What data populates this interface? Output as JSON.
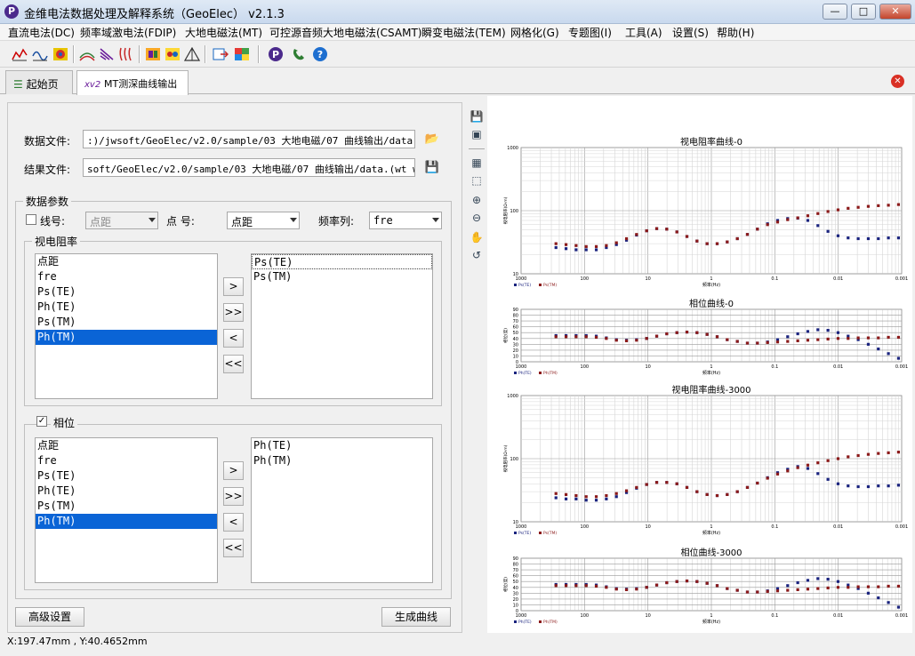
{
  "window": {
    "title": "金维电法数据处理及解释系统（GeoElec） v2.1.3",
    "logo": "P"
  },
  "menu": [
    "直流电法(DC)",
    "频率域激电法(FDIP)",
    "大地电磁法(MT)",
    "可控源音频大地电磁法(CSAMT)",
    "瞬变电磁法(TEM)",
    "网格化(G)",
    "专题图(I)",
    "工具(A)",
    "设置(S)",
    "帮助(H)"
  ],
  "tabs": [
    {
      "label": "起始页"
    },
    {
      "label": "MT测深曲线输出"
    }
  ],
  "form": {
    "data_file_label": "数据文件:",
    "data_file": ":)/jwsoft/GeoElec/v2.0/sample/03 大地电磁/07 曲线输出/data.csv",
    "result_file_label": "结果文件:",
    "result_file": "soft/GeoElec/v2.0/sample/03 大地电磁/07 曲线输出/data.(wt wl)",
    "params_title": "数据参数",
    "line_label": "线号:",
    "line_value": "点距",
    "point_label": "点  号:",
    "point_value": "点距",
    "freq_label": "频率列:",
    "freq_value": "fre",
    "rho_title": "视电阻率",
    "rho_left": [
      "点距",
      "fre",
      "Ps(TE)",
      "Ph(TE)",
      "Ps(TM)",
      "Ph(TM)"
    ],
    "rho_right": [
      "Ps(TE)",
      "Ps(TM)"
    ],
    "phase_title": "相位",
    "phase_checked": true,
    "phase_left": [
      "点距",
      "fre",
      "Ps(TE)",
      "Ph(TE)",
      "Ps(TM)",
      "Ph(TM)"
    ],
    "phase_right": [
      "Ph(TE)",
      "Ph(TM)"
    ],
    "move": [
      ">",
      ">>",
      "<",
      "<<"
    ],
    "advanced": "高级设置",
    "generate": "生成曲线"
  },
  "status": "X:197.47mm , Y:40.4652mm",
  "chart_data": [
    {
      "type": "scatter",
      "title": "视电阻率曲线-0",
      "xlabel": "频率(Hz)",
      "ylabel": "视电阻率(Ω·m)",
      "x_reversed": true,
      "log_x": true,
      "log_y": true,
      "ylim": [
        10,
        1000
      ],
      "xticks": [
        "1000",
        "100",
        "10",
        "1",
        "0.1",
        "0.01",
        "0.001"
      ],
      "yticks": [
        "1000",
        "100",
        "10"
      ],
      "series": [
        {
          "name": "Ps(TE)",
          "color": "#1a237e",
          "values": [
            26,
            25,
            24,
            24,
            24,
            26,
            29,
            34,
            41,
            48,
            52,
            51,
            46,
            39,
            33,
            30,
            30,
            32,
            36,
            42,
            51,
            62,
            70,
            75,
            76,
            70,
            58,
            47,
            40,
            37,
            36,
            36,
            36,
            37,
            37
          ]
        },
        {
          "name": "Ps(TM)",
          "color": "#8b1a1a",
          "values": [
            30,
            29,
            28,
            27,
            27,
            28,
            31,
            36,
            42,
            48,
            52,
            51,
            46,
            39,
            33,
            30,
            30,
            32,
            36,
            42,
            51,
            60,
            66,
            72,
            77,
            83,
            90,
            97,
            103,
            109,
            113,
            117,
            120,
            122,
            125
          ]
        }
      ]
    },
    {
      "type": "scatter",
      "title": "相位曲线-0",
      "xlabel": "频率(Hz)",
      "ylabel": "相位(度)",
      "x_reversed": true,
      "log_x": true,
      "ylim": [
        0,
        90
      ],
      "xticks": [
        "1000",
        "100",
        "10",
        "1",
        "0.1",
        "0.01",
        "0.001"
      ],
      "yticks": [
        "90",
        "80",
        "70",
        "60",
        "50",
        "40",
        "30",
        "20",
        "10",
        "0"
      ],
      "series": [
        {
          "name": "Ph(TE)",
          "color": "#1a237e",
          "values": [
            45,
            45,
            45,
            45,
            44,
            41,
            38,
            37,
            38,
            40,
            44,
            48,
            50,
            51,
            50,
            47,
            43,
            38,
            35,
            32,
            32,
            34,
            38,
            43,
            48,
            52,
            55,
            54,
            50,
            44,
            38,
            30,
            22,
            14,
            6
          ]
        },
        {
          "name": "Ph(TM)",
          "color": "#8b1a1a",
          "values": [
            43,
            43,
            43,
            43,
            42,
            40,
            37,
            36,
            37,
            40,
            44,
            48,
            50,
            51,
            50,
            47,
            43,
            38,
            35,
            32,
            32,
            33,
            34,
            35,
            36,
            37,
            38,
            39,
            40,
            40,
            41,
            41,
            41,
            42,
            42
          ]
        }
      ]
    },
    {
      "type": "scatter",
      "title": "视电阻率曲线-3000",
      "xlabel": "频率(Hz)",
      "ylabel": "视电阻率(Ω·m)",
      "x_reversed": true,
      "log_x": true,
      "log_y": true,
      "ylim": [
        10,
        1000
      ],
      "xticks": [
        "1000",
        "100",
        "10",
        "1",
        "0.1",
        "0.01",
        "0.001"
      ],
      "yticks": [
        "1000",
        "100",
        "10"
      ],
      "series": [
        {
          "name": "Ps(TE)",
          "color": "#1a237e",
          "values": [
            24,
            23,
            23,
            22,
            22,
            23,
            25,
            29,
            34,
            39,
            42,
            42,
            40,
            35,
            30,
            27,
            26,
            27,
            30,
            35,
            41,
            50,
            60,
            68,
            75,
            70,
            58,
            47,
            40,
            37,
            36,
            36,
            37,
            37,
            38
          ]
        },
        {
          "name": "Ps(TM)",
          "color": "#8b1a1a",
          "values": [
            28,
            27,
            26,
            25,
            25,
            26,
            28,
            31,
            35,
            39,
            42,
            42,
            40,
            35,
            30,
            27,
            26,
            27,
            30,
            35,
            41,
            49,
            57,
            64,
            72,
            79,
            86,
            93,
            100,
            107,
            112,
            117,
            121,
            124,
            127
          ]
        }
      ]
    },
    {
      "type": "scatter",
      "title": "相位曲线-3000",
      "xlabel": "频率(Hz)",
      "ylabel": "相位(度)",
      "x_reversed": true,
      "log_x": true,
      "ylim": [
        0,
        90
      ],
      "xticks": [
        "1000",
        "100",
        "10",
        "1",
        "0.1",
        "0.01",
        "0.001"
      ],
      "yticks": [
        "90",
        "80",
        "70",
        "60",
        "50",
        "40",
        "30",
        "20",
        "10",
        "0"
      ],
      "series": [
        {
          "name": "Ph(TE)",
          "color": "#1a237e",
          "values": [
            45,
            45,
            45,
            45,
            44,
            41,
            38,
            37,
            38,
            40,
            44,
            48,
            50,
            51,
            50,
            47,
            43,
            38,
            35,
            32,
            32,
            34,
            38,
            43,
            48,
            52,
            55,
            54,
            50,
            44,
            38,
            30,
            22,
            14,
            6
          ]
        },
        {
          "name": "Ph(TM)",
          "color": "#8b1a1a",
          "values": [
            43,
            43,
            43,
            43,
            42,
            40,
            37,
            36,
            37,
            40,
            44,
            48,
            50,
            51,
            50,
            47,
            43,
            38,
            35,
            32,
            32,
            33,
            34,
            35,
            36,
            37,
            38,
            39,
            40,
            40,
            41,
            41,
            41,
            42,
            42
          ]
        }
      ]
    }
  ]
}
